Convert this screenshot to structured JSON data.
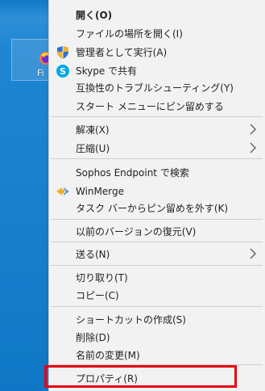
{
  "desktop": {
    "icon_label": "Fi"
  },
  "menu": {
    "open": "開く(O)",
    "open_location": "ファイルの場所を開く(I)",
    "run_as_admin": "管理者として実行(A)",
    "share_skype": "Skype で共有",
    "troubleshoot": "互換性のトラブルシューティング(Y)",
    "pin_start": "スタート メニューにピン留めする",
    "extract": "解凍(X)",
    "compress": "圧縮(U)",
    "sophos_scan": "Sophos Endpoint で検索",
    "winmerge": "WinMerge",
    "unpin_taskbar": "タスク バーからピン留めを外す(K)",
    "restore_previous": "以前のバージョンの復元(V)",
    "send_to": "送る(N)",
    "cut": "切り取り(T)",
    "copy": "コピー(C)",
    "create_shortcut": "ショートカットの作成(S)",
    "delete": "削除(D)",
    "rename": "名前の変更(M)",
    "properties": "プロパティ(R)"
  },
  "colors": {
    "highlight": "#e60012",
    "menu_bg": "#f2f2f2",
    "desktop_bg": "#1f86d2"
  }
}
